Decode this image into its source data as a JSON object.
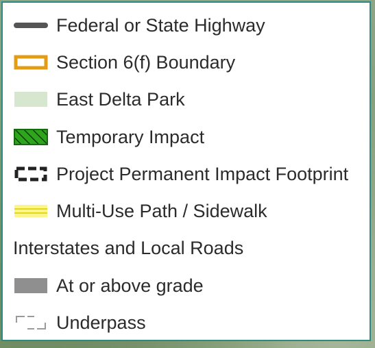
{
  "legend": {
    "items": [
      {
        "label": "Federal or State Highway",
        "icon": "highway-line-icon",
        "color": "#555555"
      },
      {
        "label": "Section 6(f) Boundary",
        "icon": "boundary-outline-icon",
        "color": "#e39c16"
      },
      {
        "label": "East Delta Park",
        "icon": "park-fill-icon",
        "color": "#d6e6cf"
      },
      {
        "label": "Temporary Impact",
        "icon": "hatched-fill-icon",
        "color": "#2fa51e"
      },
      {
        "label": "Project Permanent Impact Footprint",
        "icon": "dashed-box-icon",
        "color": "#222222"
      },
      {
        "label": "Multi-Use Path / Sidewalk",
        "icon": "double-line-icon",
        "color": "#f0ea2e"
      }
    ],
    "section_heading": "Interstates and Local Roads",
    "sub_items": [
      {
        "label": "At or above grade",
        "icon": "gray-fill-icon",
        "color": "#8f8f8f"
      },
      {
        "label": "Underpass",
        "icon": "dashed-corner-icon",
        "color": "#9a9a9a"
      }
    ]
  }
}
